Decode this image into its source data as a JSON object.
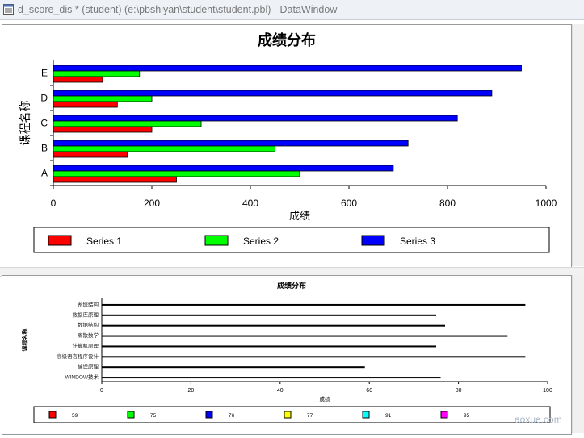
{
  "window": {
    "title": "d_score_dis * (student) (e:\\pbshiyan\\student\\student.pbl) - DataWindow"
  },
  "watermark": "aoxue.com",
  "chart_data": [
    {
      "type": "bar",
      "orientation": "horizontal",
      "title": "成绩分布",
      "xlabel": "成绩",
      "ylabel": "课程名称",
      "categories": [
        "A",
        "B",
        "C",
        "D",
        "E"
      ],
      "xlim": [
        0,
        1000
      ],
      "xticks": [
        0,
        200,
        400,
        600,
        800,
        1000
      ],
      "grid": false,
      "legend_position": "bottom",
      "series": [
        {
          "name": "Series 1",
          "color": "#ff0000",
          "values": [
            250,
            150,
            200,
            130,
            100
          ]
        },
        {
          "name": "Series 2",
          "color": "#00ff00",
          "values": [
            500,
            450,
            300,
            200,
            175
          ]
        },
        {
          "name": "Series 3",
          "color": "#0000ff",
          "values": [
            690,
            720,
            820,
            890,
            950
          ]
        }
      ]
    },
    {
      "type": "bar",
      "orientation": "horizontal",
      "title": "成绩分布",
      "xlabel": "成绩",
      "ylabel": "课程名称",
      "categories": [
        "WINDOW技术",
        "编译原理",
        "高级语言程序设计",
        "计算机原理",
        "离散数学",
        "数据结构",
        "数据库原理",
        "系统结构"
      ],
      "values": [
        76,
        59,
        95,
        75,
        91,
        77,
        75,
        95
      ],
      "xlim": [
        0,
        100
      ],
      "xticks": [
        0,
        20,
        40,
        60,
        80,
        100
      ],
      "grid": false,
      "legend_position": "bottom",
      "legend": [
        {
          "label": "59",
          "color": "#ff0000"
        },
        {
          "label": "75",
          "color": "#00ff00"
        },
        {
          "label": "76",
          "color": "#0000ff"
        },
        {
          "label": "77",
          "color": "#ffff00"
        },
        {
          "label": "91",
          "color": "#00ffff"
        },
        {
          "label": "95",
          "color": "#ff00ff"
        }
      ]
    }
  ]
}
